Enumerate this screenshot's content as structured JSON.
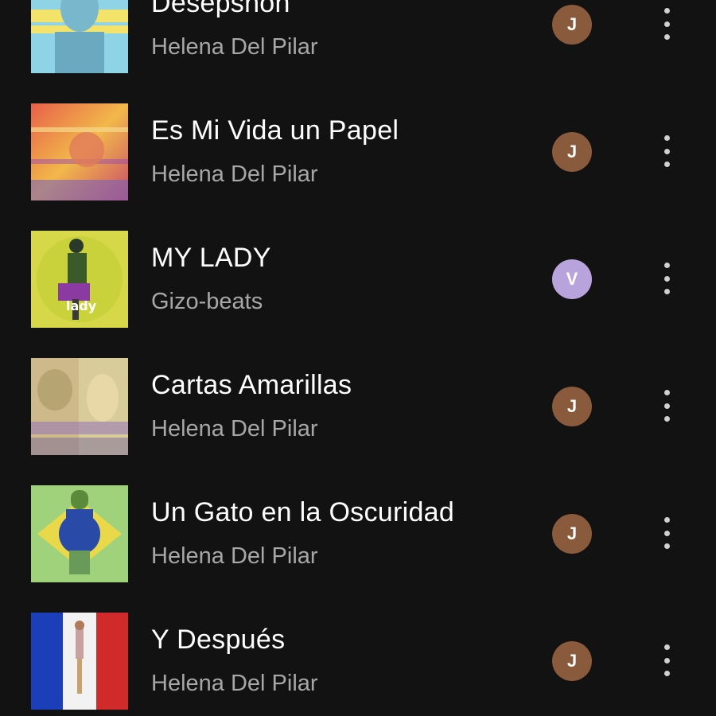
{
  "colors": {
    "background": "#121212",
    "title": "#ffffff",
    "subtitle": "#a7a7a7",
    "avatar_j": "#8a5a3c",
    "avatar_v": "#b9a3dd"
  },
  "tracks": [
    {
      "title": "Desepshon",
      "artist": "Helena Del Pilar",
      "avatar_letter": "J",
      "avatar_color": "#8a5a3c"
    },
    {
      "title": "Es Mi Vida un Papel",
      "artist": "Helena Del Pilar",
      "avatar_letter": "J",
      "avatar_color": "#8a5a3c"
    },
    {
      "title": "MY LADY",
      "artist": "Gizo-beats",
      "avatar_letter": "V",
      "avatar_color": "#b9a3dd"
    },
    {
      "title": "Cartas Amarillas",
      "artist": "Helena Del Pilar",
      "avatar_letter": "J",
      "avatar_color": "#8a5a3c"
    },
    {
      "title": "Un Gato en la Oscuridad",
      "artist": "Helena Del Pilar",
      "avatar_letter": "J",
      "avatar_color": "#8a5a3c"
    },
    {
      "title": "Y Después",
      "artist": "Helena Del Pilar",
      "avatar_letter": "J",
      "avatar_color": "#8a5a3c"
    }
  ],
  "icons": {
    "more": "more-vertical-icon",
    "art": "album-art-image"
  }
}
